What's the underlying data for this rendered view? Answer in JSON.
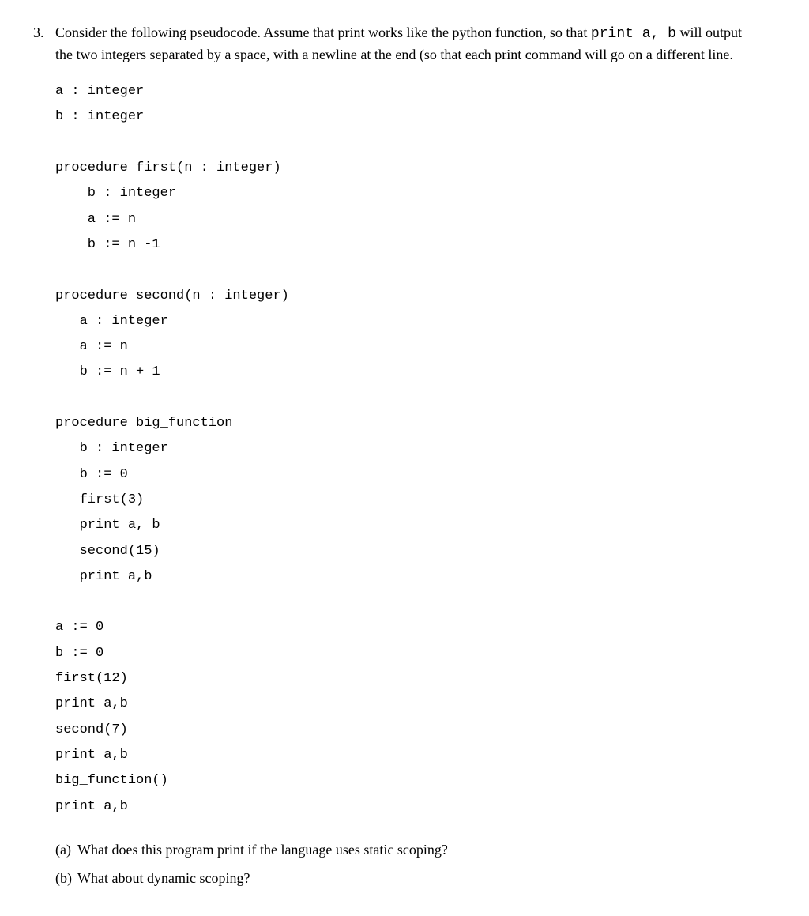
{
  "question": {
    "number": "3.",
    "intro_part1": "Consider the following pseudocode.  Assume that print works like the python function, so that ",
    "intro_code1": "print a, b",
    "intro_part2": " will output the two integers separated by a space, with a newline at the end (so that each print command will go on a different line."
  },
  "code": "a : integer\nb : integer\n\nprocedure first(n : integer)\n    b : integer\n    a := n\n    b := n -1\n\nprocedure second(n : integer)\n   a : integer\n   a := n\n   b := n + 1\n\nprocedure big_function\n   b : integer\n   b := 0\n   first(3)\n   print a, b\n   second(15)\n   print a,b\n\na := 0\nb := 0\nfirst(12)\nprint a,b\nsecond(7)\nprint a,b\nbig_function()\nprint a,b",
  "subparts": {
    "a": {
      "label": "(a)",
      "text": "What does this program print if the language uses static scoping?"
    },
    "b": {
      "label": "(b)",
      "text": "What about dynamic scoping?"
    }
  }
}
